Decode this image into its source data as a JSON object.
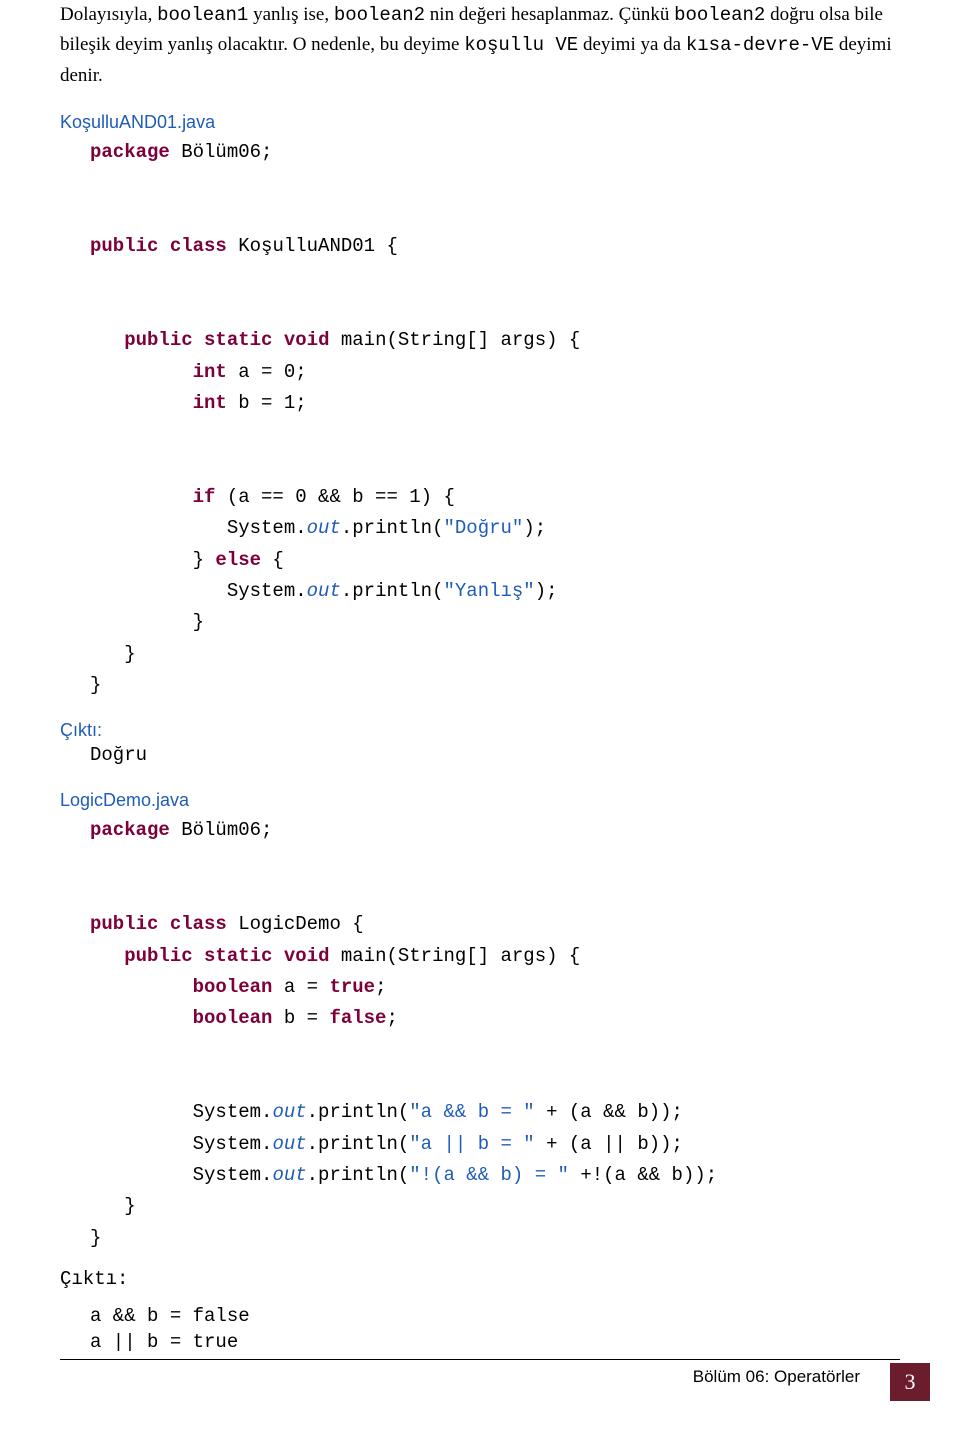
{
  "para1": {
    "t1": "Dolayısıyla, ",
    "c1": "boolean1",
    "t2": " yanlış ise, ",
    "c2": "boolean2",
    "t3": "  nin değeri hesaplanmaz. Çünkü ",
    "c3": "boolean2",
    "t4": " doğru olsa bile bileşik deyim yanlış olacaktır. O nedenle, bu deyime ",
    "c4": "koşullu VE",
    "t5": " deyimi ya da ",
    "c5": "kısa-devre-VE",
    "t6": " deyimi denir."
  },
  "file1_label": "KoşulluAND01.java",
  "code1": {
    "l01a": "package",
    "l01b": " Bölüm06;",
    "l02a": "public",
    "l02b": " ",
    "l02c": "class",
    "l02d": " KoşulluAND01 {",
    "l03a": "   public",
    "l03b": " ",
    "l03c": "static",
    "l03d": " ",
    "l03e": "void",
    "l03f": " main(String[] args) {",
    "l04a": "         int",
    "l04b": " a = 0;",
    "l05a": "         int",
    "l05b": " b = 1;",
    "l06a": "         if",
    "l06b": " (a == 0 && b == 1) {",
    "l07a": "            System.",
    "l07b": "out",
    "l07c": ".println(",
    "l07d": "\"Doğru\"",
    "l07e": ");",
    "l08a": "         } ",
    "l08b": "else",
    "l08c": " {",
    "l09a": "            System.",
    "l09b": "out",
    "l09c": ".println(",
    "l09d": "\"Yanlış\"",
    "l09e": ");",
    "l10": "         }",
    "l11": "   }",
    "l12": "}"
  },
  "out1_label": "Çıktı:",
  "out1_text": "Doğru",
  "file2_label": "LogicDemo.java",
  "code2": {
    "l01a": "package",
    "l01b": " Bölüm06;",
    "l02a": "public",
    "l02b": " ",
    "l02c": "class",
    "l02d": " LogicDemo {",
    "l03a": "   public",
    "l03b": " ",
    "l03c": "static",
    "l03d": " ",
    "l03e": "void",
    "l03f": " main(String[] args) {",
    "l04a": "         boolean",
    "l04b": " a = ",
    "l04c": "true",
    "l04d": ";",
    "l05a": "         boolean",
    "l05b": " b = ",
    "l05c": "false",
    "l05d": ";",
    "l06a": "         System.",
    "l06b": "out",
    "l06c": ".println(",
    "l06d": "\"a && b = \"",
    "l06e": " + (a && b));",
    "l07a": "         System.",
    "l07b": "out",
    "l07c": ".println(",
    "l07d": "\"a || b = \"",
    "l07e": " + (a || b));",
    "l08a": "         System.",
    "l08b": "out",
    "l08c": ".println(",
    "l08d": "\"!(a && b) = \"",
    "l08e": " +!(a && b));",
    "l09": "   }",
    "l10": "}"
  },
  "out2_label": "Çıktı:",
  "out2_line1": "a && b = false",
  "out2_line2": "a || b = true",
  "footer_text": "Bölüm 06: Operatörler",
  "footer_page": "3"
}
